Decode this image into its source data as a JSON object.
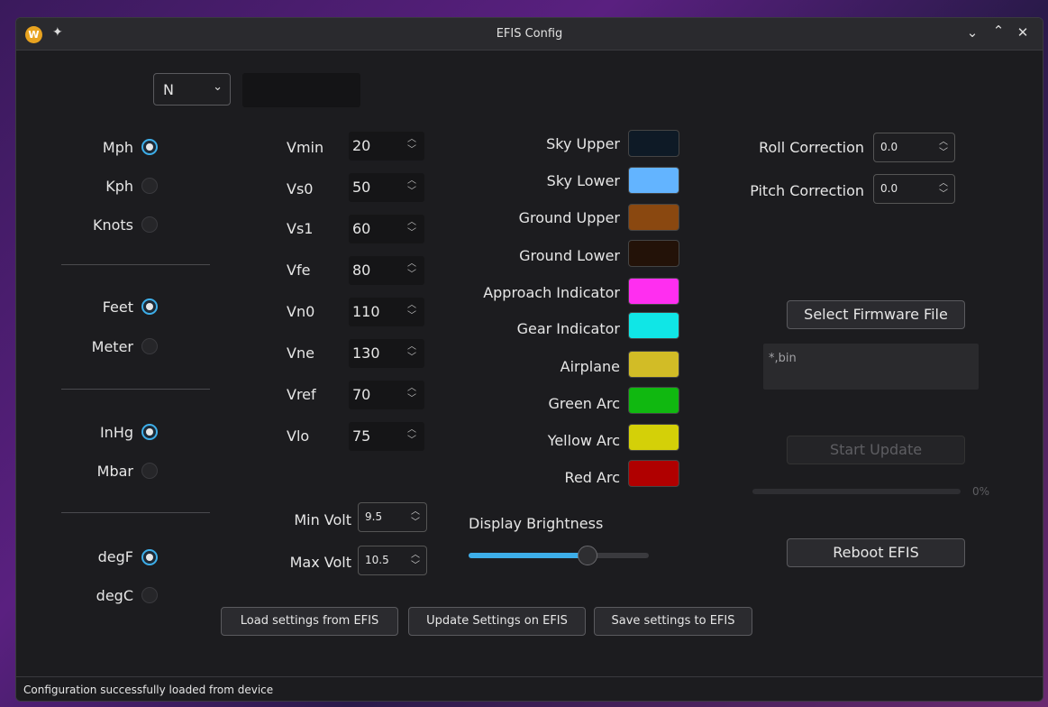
{
  "window": {
    "title": "EFIS Config"
  },
  "top": {
    "selected_value": "N",
    "text_value": ""
  },
  "speed_units": [
    {
      "label": "Mph",
      "checked": true
    },
    {
      "label": "Kph",
      "checked": false
    },
    {
      "label": "Knots",
      "checked": false
    }
  ],
  "altitude_units": [
    {
      "label": "Feet",
      "checked": true
    },
    {
      "label": "Meter",
      "checked": false
    }
  ],
  "pressure_units": [
    {
      "label": "InHg",
      "checked": true
    },
    {
      "label": "Mbar",
      "checked": false
    }
  ],
  "temperature_units": [
    {
      "label": "degF",
      "checked": true
    },
    {
      "label": "degC",
      "checked": false
    }
  ],
  "speeds": [
    {
      "label": "Vmin",
      "value": "20"
    },
    {
      "label": "Vs0",
      "value": "50"
    },
    {
      "label": "Vs1",
      "value": "60"
    },
    {
      "label": "Vfe",
      "value": "80"
    },
    {
      "label": "Vn0",
      "value": "110"
    },
    {
      "label": "Vne",
      "value": "130"
    },
    {
      "label": "Vref",
      "value": "70"
    },
    {
      "label": "Vlo",
      "value": "75"
    }
  ],
  "volts": {
    "min_label": "Min Volt",
    "min_value": "9.5",
    "max_label": "Max Volt",
    "max_value": "10.5"
  },
  "colors": [
    {
      "label": "Sky Upper",
      "color": "#0e1a26"
    },
    {
      "label": "Sky Lower",
      "color": "#63b4ff"
    },
    {
      "label": "Ground Upper",
      "color": "#8a4810"
    },
    {
      "label": "Ground Lower",
      "color": "#231208"
    },
    {
      "label": "Approach Indicator",
      "color": "#ff2ef0"
    },
    {
      "label": "Gear Indicator",
      "color": "#10e6e6"
    },
    {
      "label": "Airplane",
      "color": "#d2bc26"
    },
    {
      "label": "Green Arc",
      "color": "#10b810"
    },
    {
      "label": "Yellow Arc",
      "color": "#d4d008"
    },
    {
      "label": "Red Arc",
      "color": "#b00000"
    }
  ],
  "brightness": {
    "label": "Display Brightness",
    "value": 0.66
  },
  "corrections": {
    "roll_label": "Roll Correction",
    "roll_value": "0.0",
    "pitch_label": "Pitch Correction",
    "pitch_value": "0.0"
  },
  "firmware": {
    "select_label": "Select Firmware File",
    "file_text": "*,bin",
    "start_label": "Start Update",
    "progress_text": "0%",
    "progress": 0
  },
  "reboot_label": "Reboot EFIS",
  "bottom_buttons": {
    "load": "Load settings from EFIS",
    "update": "Update Settings on EFIS",
    "save": "Save settings to EFIS"
  },
  "status": "Configuration successfully loaded from device",
  "accent_color": "#3daee9"
}
